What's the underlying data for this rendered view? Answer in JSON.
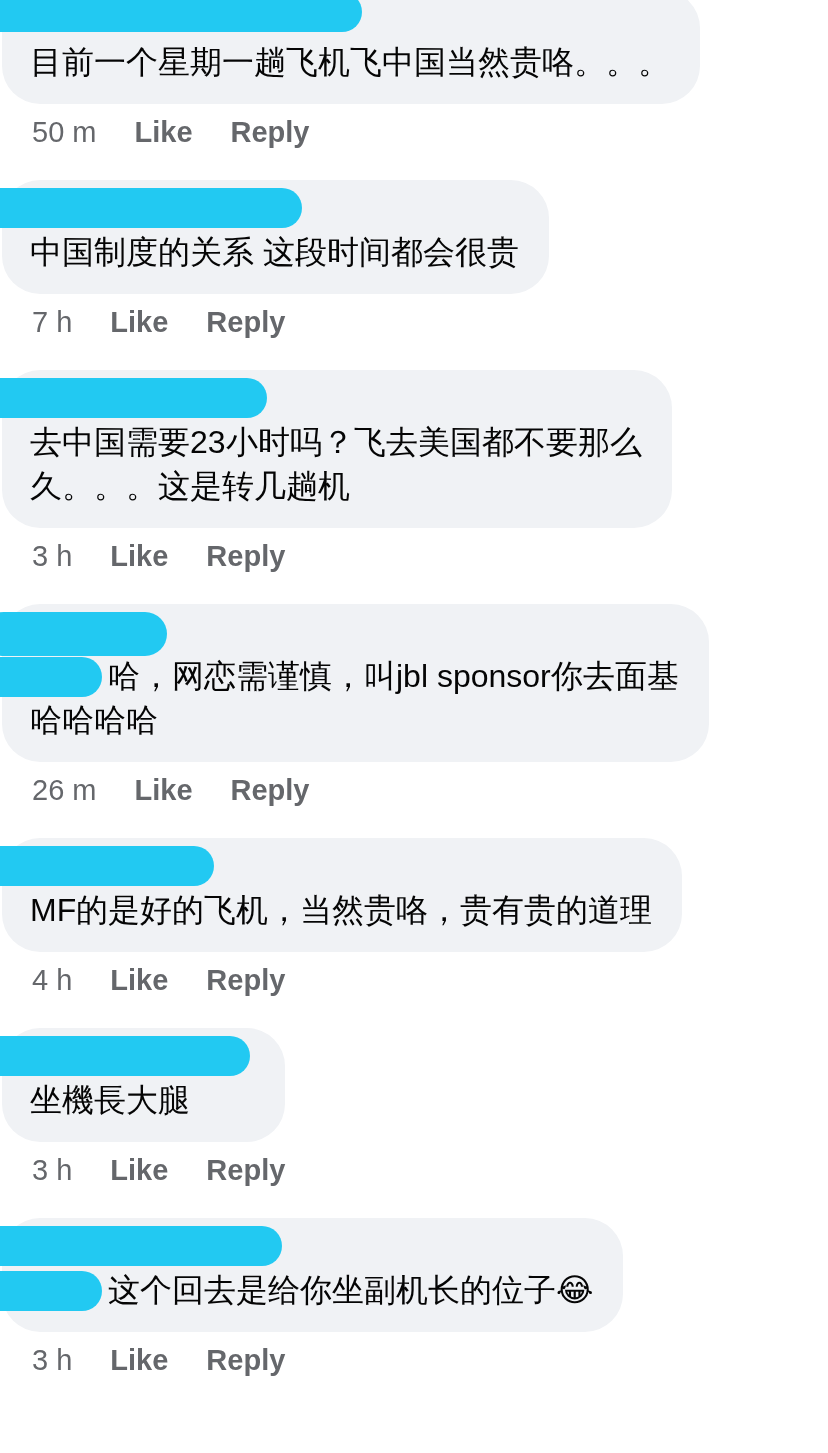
{
  "comments": [
    {
      "lines": [
        "目前一个星期一趟飞机飞中国当然贵咯。。。"
      ],
      "text_start_hidden": false,
      "time": "50 m",
      "like": "Like",
      "reply": "Reply"
    },
    {
      "lines": [
        "中国制度的关系 这段时间都会很贵"
      ],
      "text_start_hidden": false,
      "time": "7 h",
      "like": "Like",
      "reply": "Reply"
    },
    {
      "lines": [
        "去中国需要23小时吗？飞去美国都不要那么",
        "久。。。这是转几趟机"
      ],
      "text_start_hidden": false,
      "time": "3 h",
      "like": "Like",
      "reply": "Reply"
    },
    {
      "lines": [
        "哈，网恋需谨慎，叫jbl sponsor你去面基",
        "哈哈哈哈"
      ],
      "text_start_hidden": true,
      "time": "26 m",
      "like": "Like",
      "reply": "Reply"
    },
    {
      "lines": [
        "MF的是好的飞机，当然贵咯，贵有贵的道理"
      ],
      "text_start_hidden": false,
      "time": "4 h",
      "like": "Like",
      "reply": "Reply"
    },
    {
      "lines": [
        "坐機長大腿"
      ],
      "text_start_hidden": false,
      "time": "3 h",
      "like": "Like",
      "reply": "Reply"
    },
    {
      "lines": [
        "这个回去是给你坐副机长的位子😂"
      ],
      "text_start_hidden": true,
      "time": "3 h",
      "like": "Like",
      "reply": "Reply"
    }
  ]
}
